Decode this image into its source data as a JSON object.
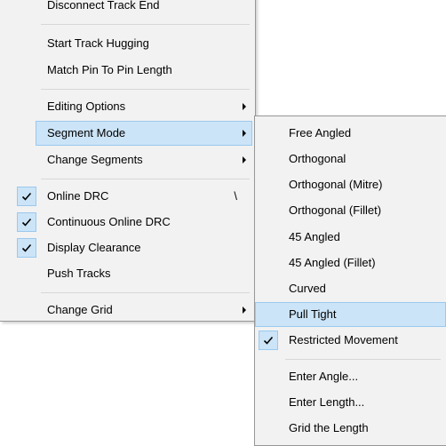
{
  "main_menu": {
    "items": [
      {
        "label": "Disconnect Track End"
      },
      {
        "label": "Start Track Hugging"
      },
      {
        "label": "Match Pin To Pin Length"
      },
      {
        "label": "Editing Options"
      },
      {
        "label": "Segment Mode"
      },
      {
        "label": "Change Segments"
      },
      {
        "label": "Online DRC",
        "shortcut": "\\",
        "checked": true
      },
      {
        "label": "Continuous Online DRC",
        "checked": true
      },
      {
        "label": "Display Clearance",
        "checked": true
      },
      {
        "label": "Push Tracks"
      },
      {
        "label": "Change Grid"
      }
    ]
  },
  "sub_menu": {
    "items": [
      {
        "label": "Free Angled"
      },
      {
        "label": "Orthogonal"
      },
      {
        "label": "Orthogonal (Mitre)"
      },
      {
        "label": "Orthogonal (Fillet)"
      },
      {
        "label": "45 Angled"
      },
      {
        "label": "45 Angled (Fillet)"
      },
      {
        "label": "Curved"
      },
      {
        "label": "Pull Tight"
      },
      {
        "label": "Restricted Movement",
        "checked": true
      },
      {
        "label": "Enter Angle..."
      },
      {
        "label": "Enter Length..."
      },
      {
        "label": "Grid the Length"
      }
    ]
  },
  "colors": {
    "menu_bg": "#f2f2f2",
    "highlight_bg": "#cce4f7",
    "highlight_border": "#99c9ef",
    "separator": "#d7d7d7"
  },
  "icons": {
    "check": "check-icon",
    "submenu_arrow": "chevron-right-icon"
  }
}
